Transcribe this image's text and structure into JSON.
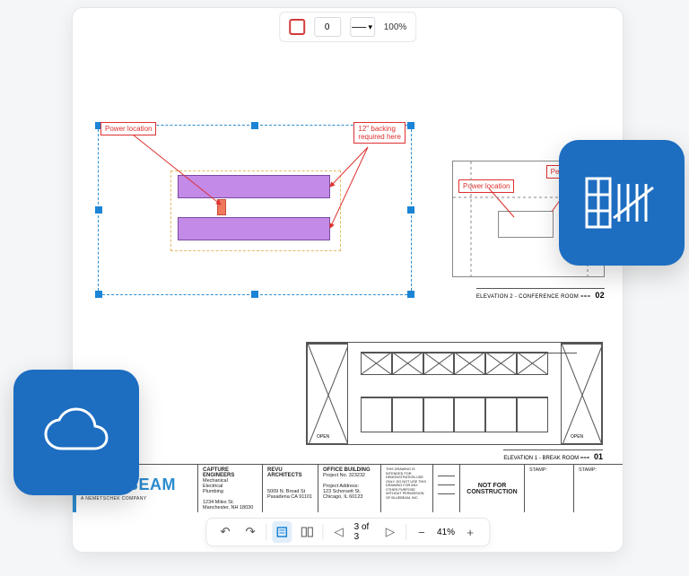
{
  "toolbar": {
    "stroke_value": "0",
    "zoom_label": "100%"
  },
  "callouts": {
    "power": "Power location",
    "backing": "12\" backing\nrequired here",
    "mini_power": "Power location",
    "mini_av": "Per AV spec, d"
  },
  "elevations": {
    "right_caption": "ELEVATION 2 - CONFERENCE ROOM ===",
    "right_number": "02",
    "lower_caption": "ELEVATION 1 - BREAK ROOM ===",
    "lower_number": "01",
    "open_label": "OPEN"
  },
  "titleblock": {
    "brand": "BLUEBEAM",
    "brand_sub": "A NEMETSCHEK COMPANY",
    "engineers_head": "CAPTURE ENGINEERS",
    "engineers_body": "Mechanical\nElectrical\nPlumbing\n\n1234 Miles St.\nManchester, NH 18030",
    "architects_head": "REVU ARCHITECTS",
    "architects_body": "5009 N. Broad St\nPasadena CA 91101",
    "project_head": "OFFICE BUILDING",
    "project_body": "Project No. 323232\n\nProject Address:\n123 Schorsett St.\nChicago, IL 60123",
    "status": "NOT FOR CONSTRUCTION",
    "stamp": "STAMP:"
  },
  "bottom": {
    "page_label": "3 of 3",
    "zoom_label": "41%"
  }
}
